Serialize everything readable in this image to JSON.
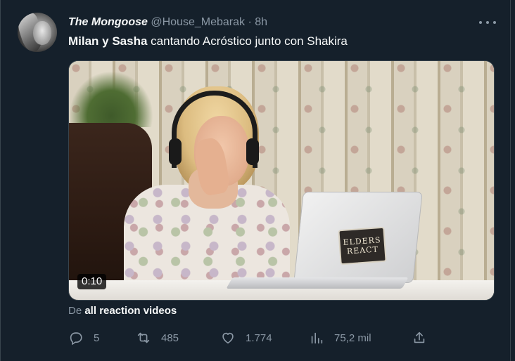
{
  "author": {
    "display_name": "The Mongoose",
    "handle": "@House_Mebarak",
    "separator": "·",
    "time": "8h"
  },
  "tweet": {
    "text_bold": "Milan y Sasha",
    "text_rest": " cantando Acróstico junto con Shakira"
  },
  "media": {
    "duration": "0:10",
    "sticker_line1": "ELDERS",
    "sticker_line2": "REACT"
  },
  "source": {
    "prefix": "De ",
    "name": "all reaction videos"
  },
  "actions": {
    "replies": "5",
    "retweets": "485",
    "likes": "1.774",
    "views": "75,2 mil"
  },
  "icons": {
    "more": "more-horizontal-icon",
    "reply": "reply-icon",
    "retweet": "retweet-icon",
    "like": "heart-icon",
    "views": "views-icon",
    "share": "share-icon"
  },
  "colors": {
    "background": "#15202b",
    "text_primary": "#f7f9f9",
    "text_secondary": "#8b98a5",
    "border": "#38444d"
  }
}
